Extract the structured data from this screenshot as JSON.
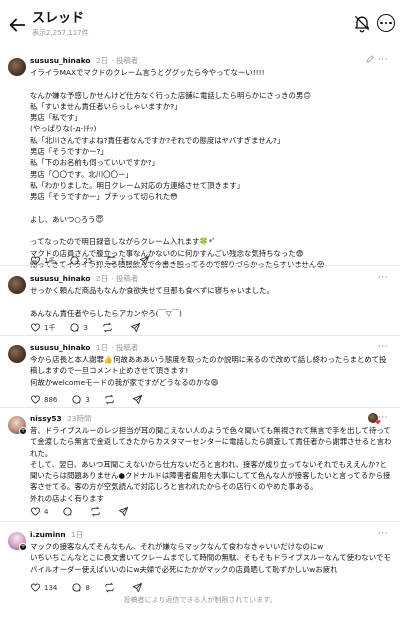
{
  "header": {
    "title": "スレッド",
    "views": "表示2,257,117件"
  },
  "posts": [
    {
      "user": "sususu_hinako",
      "time": "2日",
      "tag": "投稿者",
      "paragraphs": [
        "イライラMAXでマクドのクレーム言うとググッたら今やってなーい!!!!",
        "なんか嫌な予感しかせんけど仕方なく行った店舗に電話したら明らかにさっきの男🙃\n私「すいません責任者いらっしゃいますか?」\n男店「私です」\n(やっぱりな(-д-)ﾁｯ)\n私「北川さんですよね?責任者なんですか?それでの態度はヤバすぎません?」\n男店「そうですかー?」\n私「下のお名前も伺っていいですか?」\n男店「〇〇です。北川〇〇ー」\n私「わかりました。明日クレーム対応の方連絡させて頂きます」\n男店「そうですかー」ブチッって切られた😳",
        "よし、あいつ○ろう😇",
        "ってなったので明日録音しながらクレーム入れます🍀*゜\nマクドの店員さんで腹立った事なんかないのに何かすんごい残念な気持ちなった😨\n帰ってきてイライラ抑える頓服飲んで今書き殴ってるので解りづらかったらすいません😭"
      ],
      "likes": "1千",
      "replies": "25",
      "reposts": "1",
      "shares": ""
    },
    {
      "user": "sususu_hinako",
      "time": "2日",
      "tag": "投稿者",
      "paragraphs": [
        "せっかく頼んだ商品もなんか食欲失せて旦那も食べずに寝ちゃいました。",
        "あんなん責任者やらしたらアカンやろ(￣▽￣)"
      ],
      "likes": "1千",
      "replies": "3",
      "reposts": "",
      "shares": ""
    },
    {
      "user": "sususu_hinako",
      "time": "1日",
      "tag": "投稿者",
      "paragraphs": [
        "今から店長と本人謝罪👍何故あああいう態度を取ったのか説明に来るので改めて話し終わったらまとめて投稿しますので一旦コメント止めさせて頂きます!\n何故かwelcomeモードの我が家ですがどうなるのかな😄"
      ],
      "likes": "886",
      "replies": "3",
      "reposts": "",
      "shares": ""
    },
    {
      "user": "nissy53",
      "time": "23時間",
      "tag": "",
      "paragraphs": [
        "昔、ドライブスルーのレジ担当が耳の聞こえない人のようで色々聞いても無視されて無言で手を出して待ってて金渡したら無言で金返してきたからカスタマーセンターに電話したら調査して責任者から謝罪させると言われた。\nそして、翌日、あいつ耳聞こえないから仕方ないだろと言われ、接客が成り立ってないそれでもええんか?と聞いたらは問題ありません●クドナルドは障害者雇用を大事にしてて色んな人が接客したいと言ってるから接客させてる。客の方が空気読んで対応しろと言われたからその店行くのやめた事ある。\n外れの店よく有ります"
      ],
      "likes": "4",
      "replies": "",
      "reposts": "",
      "shares": ""
    },
    {
      "user": "i.zuminn",
      "time": "1日",
      "tag": "",
      "paragraphs": [
        "マックの接客なんてそんなもん、それが嫌ならマックなんて食わなきゃいいだけなのにw\nいちいちこんなとこに長文書いてクレームまでして時間の無駄、そもそもドライブスルーなんて使わないでモバイルオーダー使えばいいのにw夫婦で必死にたかがマックの店員晒して恥ずかしいwお疲れ"
      ],
      "likes": "134",
      "replies": "8",
      "reposts": "",
      "shares": ""
    }
  ],
  "footer": {
    "note": "投稿者により返信できる人が制限されています。"
  }
}
